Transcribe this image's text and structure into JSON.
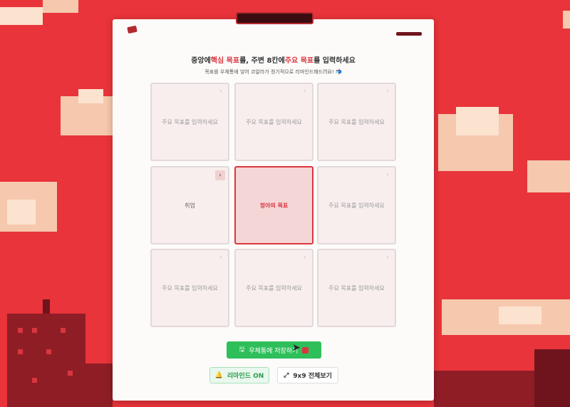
{
  "header": {
    "title_parts": [
      "중앙에",
      "핵심 목표",
      "를, 주변 8칸에",
      "주요 목표",
      "를 입력하세요"
    ],
    "subtitle": "목표를 우체통에 넣어 코알라가 정기적으로 리마인드해드려요! 📬"
  },
  "grid": {
    "cells": [
      {
        "text": "주요 목표를 입력하세요",
        "arrow": "›"
      },
      {
        "text": "주요 목표를 입력하세요",
        "arrow": "›"
      },
      {
        "text": "주요 목표를 입력하세요",
        "arrow": "›"
      },
      {
        "text": "취업",
        "arrow": "›"
      },
      {
        "text": "정아의 목표",
        "arrow": ""
      },
      {
        "text": "주요 목표를 입력하세요",
        "arrow": "›"
      },
      {
        "text": "주요 목표를 입력하세요",
        "arrow": "›"
      },
      {
        "text": "주요 목표를 입력하세요",
        "arrow": "›"
      },
      {
        "text": "주요 목표를 입력하세요",
        "arrow": "›"
      }
    ]
  },
  "actions": {
    "save_icon": "🖫",
    "save_label": "우체통에 저장하기",
    "remind_icon": "🔔",
    "remind_label": "리마인드 ON",
    "fullview_icon": "⤢",
    "fullview_label": "9x9 전체보기"
  },
  "icons": {
    "save": "save-icon",
    "postbox": "postbox-icon",
    "bell": "bell-icon",
    "expand": "expand-icon",
    "chevron": "chevron-right-icon"
  },
  "colors": {
    "background": "#e8343a",
    "accent": "#d9363f",
    "save_button": "#2fbf5a",
    "remind_text": "#2a9a4c"
  }
}
